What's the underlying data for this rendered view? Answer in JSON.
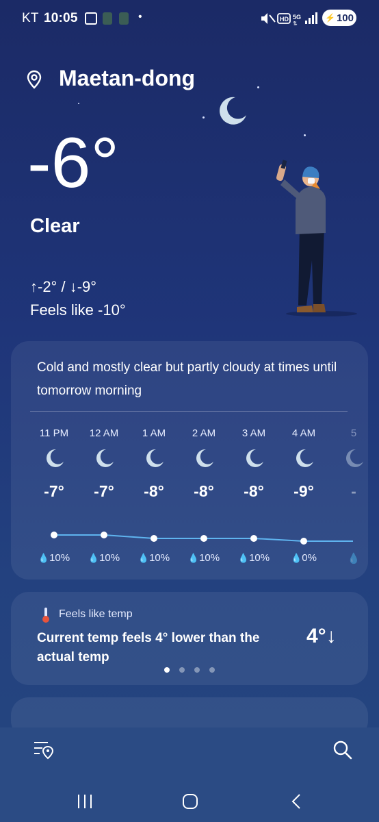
{
  "status_bar": {
    "carrier": "KT",
    "time": "10:05",
    "dot": "•",
    "battery": "100",
    "icons": [
      "twitch-icon",
      "app-icon",
      "app-icon",
      "mute-icon",
      "hd-icon",
      "5g-icon",
      "signal-icon"
    ]
  },
  "location": {
    "name": "Maetan-dong",
    "icon": "location-pin-icon"
  },
  "current": {
    "temp": "-6°",
    "condition": "Clear",
    "hi_lo": "↑-2° / ↓-9°",
    "feels_like": "Feels like -10°"
  },
  "forecast_card": {
    "summary": "Cold and mostly clear but partly cloudy at times until tomorrow morning",
    "hours": [
      {
        "time": "11 PM",
        "temp": "-7°",
        "precip": "10%",
        "icon": "moon-icon"
      },
      {
        "time": "12 AM",
        "temp": "-7°",
        "precip": "10%",
        "icon": "moon-icon"
      },
      {
        "time": "1 AM",
        "temp": "-8°",
        "precip": "10%",
        "icon": "moon-icon"
      },
      {
        "time": "2 AM",
        "temp": "-8°",
        "precip": "10%",
        "icon": "moon-icon"
      },
      {
        "time": "3 AM",
        "temp": "-8°",
        "precip": "10%",
        "icon": "moon-icon"
      },
      {
        "time": "4 AM",
        "temp": "-9°",
        "precip": "0%",
        "icon": "moon-icon"
      },
      {
        "time": "5",
        "temp": "-",
        "precip": "",
        "icon": "moon-icon"
      }
    ]
  },
  "feels_card": {
    "label": "Feels like temp",
    "description": "Current temp feels 4° lower than the actual temp",
    "delta": "4°↓",
    "pages": 4,
    "active_page": 0
  },
  "colors": {
    "accent_line": "#5fb4ef",
    "moon": "#cfe0ec"
  }
}
